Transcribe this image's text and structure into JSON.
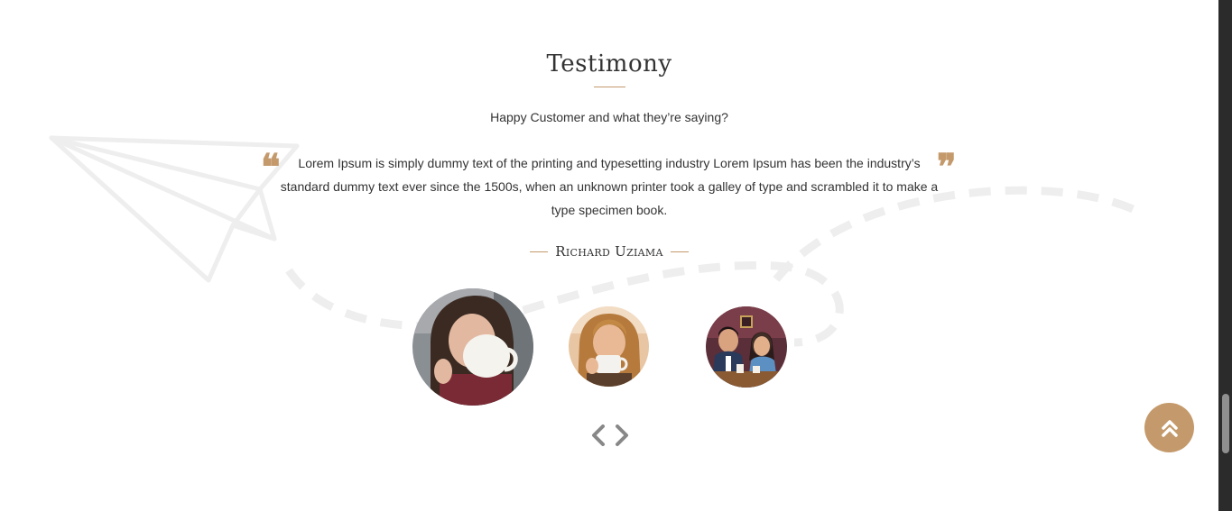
{
  "section": {
    "title": "Testimony",
    "subtitle": "Happy Customer and what they’re saying?"
  },
  "testimonial": {
    "quote": "Lorem Ipsum is simply dummy text of the printing and typesetting industry Lorem Ipsum has been the industry’s standard dummy text ever since the 1500s, when an unknown printer took a galley of type and scrambled it to make a type specimen book.",
    "author": "Richard Uziama",
    "open_quote_glyph": "❝",
    "close_quote_glyph": "❞"
  },
  "avatars": [
    {
      "icon": "woman-drinking-coffee-photo",
      "active": true
    },
    {
      "icon": "woman-sipping-cup-photo",
      "active": false
    },
    {
      "icon": "couple-in-cafe-photo",
      "active": false
    }
  ],
  "navigation": {
    "prev_icon": "chevron-left-icon",
    "next_icon": "chevron-right-icon"
  },
  "back_to_top": {
    "icon": "double-chevron-up-icon"
  },
  "colors": {
    "accent": "#c49a6c",
    "text": "#333333",
    "decoration": "#eeeeee",
    "arrows": "#888888"
  }
}
